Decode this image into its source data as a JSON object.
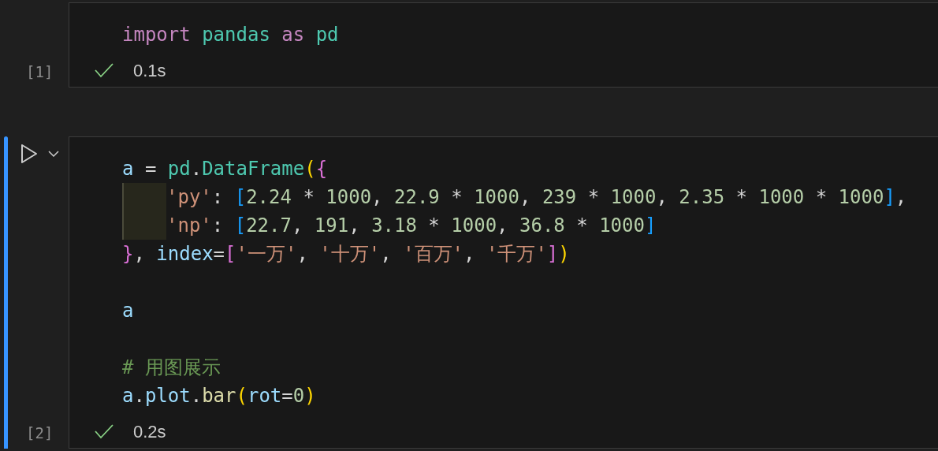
{
  "cells": [
    {
      "selected": false,
      "count": "[1]",
      "succeeded": true,
      "duration": "0.1s",
      "lines": [
        {
          "kind": "code",
          "indent": false,
          "tokens": [
            {
              "text": "import ",
              "kind": "keyword"
            },
            {
              "text": "pandas ",
              "kind": "module"
            },
            {
              "text": "as ",
              "kind": "keyword"
            },
            {
              "text": "pd",
              "kind": "module"
            }
          ]
        }
      ]
    },
    {
      "selected": true,
      "count": "[2]",
      "succeeded": true,
      "duration": "0.2s",
      "lines": [
        {
          "kind": "code",
          "indent": false,
          "tokens": [
            {
              "text": "a",
              "kind": "var"
            },
            {
              "text": " = ",
              "kind": "op"
            },
            {
              "text": "pd",
              "kind": "module"
            },
            {
              "text": ".",
              "kind": "op"
            },
            {
              "text": "DataFrame",
              "kind": "module"
            },
            {
              "text": "(",
              "kind": "bracket1"
            },
            {
              "text": "{",
              "kind": "bracket2"
            }
          ]
        },
        {
          "kind": "code",
          "indent": true,
          "tokens": [
            {
              "text": "'py'",
              "kind": "string"
            },
            {
              "text": ": ",
              "kind": "op"
            },
            {
              "text": "[",
              "kind": "bracket3"
            },
            {
              "text": "2.24",
              "kind": "number"
            },
            {
              "text": " * ",
              "kind": "op"
            },
            {
              "text": "1000",
              "kind": "number"
            },
            {
              "text": ", ",
              "kind": "op"
            },
            {
              "text": "22.9",
              "kind": "number"
            },
            {
              "text": " * ",
              "kind": "op"
            },
            {
              "text": "1000",
              "kind": "number"
            },
            {
              "text": ", ",
              "kind": "op"
            },
            {
              "text": "239",
              "kind": "number"
            },
            {
              "text": " * ",
              "kind": "op"
            },
            {
              "text": "1000",
              "kind": "number"
            },
            {
              "text": ", ",
              "kind": "op"
            },
            {
              "text": "2.35",
              "kind": "number"
            },
            {
              "text": " * ",
              "kind": "op"
            },
            {
              "text": "1000",
              "kind": "number"
            },
            {
              "text": " * ",
              "kind": "op"
            },
            {
              "text": "1000",
              "kind": "number"
            },
            {
              "text": "]",
              "kind": "bracket3"
            },
            {
              "text": ",",
              "kind": "op"
            }
          ]
        },
        {
          "kind": "code",
          "indent": true,
          "tokens": [
            {
              "text": "'np'",
              "kind": "string"
            },
            {
              "text": ": ",
              "kind": "op"
            },
            {
              "text": "[",
              "kind": "bracket3"
            },
            {
              "text": "22.7",
              "kind": "number"
            },
            {
              "text": ", ",
              "kind": "op"
            },
            {
              "text": "191",
              "kind": "number"
            },
            {
              "text": ", ",
              "kind": "op"
            },
            {
              "text": "3.18",
              "kind": "number"
            },
            {
              "text": " * ",
              "kind": "op"
            },
            {
              "text": "1000",
              "kind": "number"
            },
            {
              "text": ", ",
              "kind": "op"
            },
            {
              "text": "36.8",
              "kind": "number"
            },
            {
              "text": " * ",
              "kind": "op"
            },
            {
              "text": "1000",
              "kind": "number"
            },
            {
              "text": "]",
              "kind": "bracket3"
            }
          ]
        },
        {
          "kind": "code",
          "indent": false,
          "tokens": [
            {
              "text": "}",
              "kind": "bracket2"
            },
            {
              "text": ", ",
              "kind": "op"
            },
            {
              "text": "index",
              "kind": "var"
            },
            {
              "text": "=",
              "kind": "op"
            },
            {
              "text": "[",
              "kind": "bracket2"
            },
            {
              "text": "'一万'",
              "kind": "string"
            },
            {
              "text": ", ",
              "kind": "op"
            },
            {
              "text": "'十万'",
              "kind": "string"
            },
            {
              "text": ", ",
              "kind": "op"
            },
            {
              "text": "'百万'",
              "kind": "string"
            },
            {
              "text": ", ",
              "kind": "op"
            },
            {
              "text": "'千万'",
              "kind": "string"
            },
            {
              "text": "]",
              "kind": "bracket2"
            },
            {
              "text": ")",
              "kind": "bracket1"
            }
          ]
        },
        {
          "kind": "blank"
        },
        {
          "kind": "code",
          "indent": false,
          "tokens": [
            {
              "text": "a",
              "kind": "var"
            }
          ]
        },
        {
          "kind": "blank"
        },
        {
          "kind": "code",
          "indent": false,
          "tokens": [
            {
              "text": "# 用图展示",
              "kind": "comment"
            }
          ]
        },
        {
          "kind": "code",
          "indent": false,
          "tokens": [
            {
              "text": "a",
              "kind": "var"
            },
            {
              "text": ".",
              "kind": "op"
            },
            {
              "text": "plot",
              "kind": "var"
            },
            {
              "text": ".",
              "kind": "op"
            },
            {
              "text": "bar",
              "kind": "func"
            },
            {
              "text": "(",
              "kind": "bracket1"
            },
            {
              "text": "rot",
              "kind": "var"
            },
            {
              "text": "=",
              "kind": "op"
            },
            {
              "text": "0",
              "kind": "number"
            },
            {
              "text": ")",
              "kind": "bracket1"
            }
          ]
        }
      ]
    }
  ]
}
